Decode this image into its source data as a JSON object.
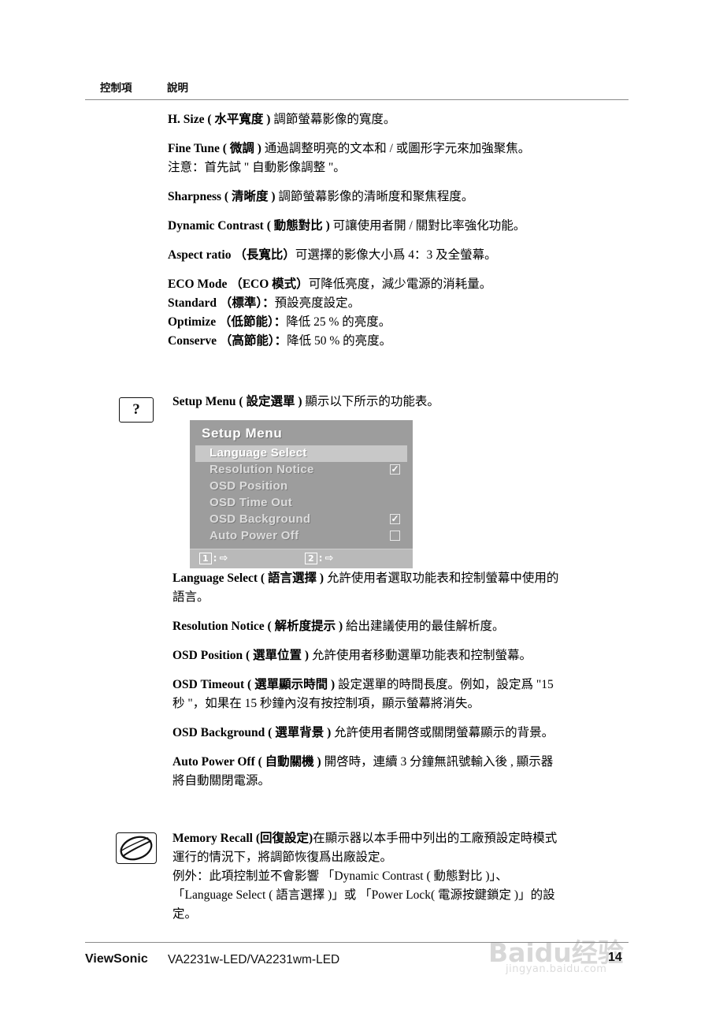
{
  "header": {
    "col1": "控制項",
    "col2": "說明"
  },
  "entries": [
    {
      "id": "h-size",
      "lines": [
        {
          "bold": "H. Size ( 水平寬度 ) ",
          "rest": "調節螢幕影像的寬度。"
        }
      ]
    },
    {
      "id": "fine-tune",
      "lines": [
        {
          "bold": "Fine Tune ( 微調 ) ",
          "rest": "通過調整明亮的文本和 / 或圖形字元來加強聚焦。"
        },
        {
          "bold": "",
          "rest": "注意：首先試 \" 自動影像調整 \"。"
        }
      ]
    },
    {
      "id": "sharpness",
      "lines": [
        {
          "bold": "Sharpness ( 清晰度 ) ",
          "rest": "調節螢幕影像的清晰度和聚焦程度。"
        }
      ]
    },
    {
      "id": "dynamic-contrast",
      "lines": [
        {
          "bold": "Dynamic Contrast ( 動態對比 ) ",
          "rest": "可讓使用者開 / 關對比率強化功能。"
        }
      ]
    },
    {
      "id": "aspect-ratio",
      "lines": [
        {
          "bold": "Aspect ratio （長寬比）",
          "rest": "可選擇的影像大小爲 4：3 及全螢幕。"
        }
      ]
    },
    {
      "id": "eco-mode",
      "lines": [
        {
          "bold": "ECO Mode （ECO 模式）",
          "rest": "可降低亮度，減少電源的消耗量。"
        },
        {
          "bold": "Standard （標準）：",
          "rest": "預設亮度設定。"
        },
        {
          "bold": "Optimize （低節能）：",
          "rest": "降低 25 % 的亮度。"
        },
        {
          "bold": "Conserve （高節能）：",
          "rest": "降低 50 % 的亮度。"
        }
      ]
    }
  ],
  "setup_menu_line": {
    "bold": "Setup Menu ( 設定選單 ) ",
    "rest": "顯示以下所示的功能表。"
  },
  "question_icon": "?",
  "osd": {
    "title": "Setup Menu",
    "rows": [
      {
        "label": "Language Select",
        "selected": true,
        "box": "none"
      },
      {
        "label": "Resolution Notice",
        "selected": false,
        "box": "checked"
      },
      {
        "label": "OSD Position",
        "selected": false,
        "box": "none"
      },
      {
        "label": "OSD Time Out",
        "selected": false,
        "box": "none"
      },
      {
        "label": "OSD Background",
        "selected": false,
        "box": "checked"
      },
      {
        "label": "Auto Power Off",
        "selected": false,
        "box": "empty"
      }
    ],
    "keys": [
      {
        "num": "1",
        "sep": ":",
        "glyph": "⇨"
      },
      {
        "num": "2",
        "sep": ":",
        "glyph": "⇨"
      }
    ],
    "check_glyph": "☑",
    "colors": {
      "background": "#9d9d9d",
      "highlight": "#c8c8c8",
      "footer": "#b9b9b9"
    }
  },
  "entries2": [
    {
      "id": "language-select",
      "lines": [
        {
          "bold": "Language Select ( 語言選擇 ) ",
          "rest": "允許使用者選取功能表和控制螢幕中使用的"
        },
        {
          "bold": "",
          "rest": "語言。"
        }
      ]
    },
    {
      "id": "resolution-notice",
      "lines": [
        {
          "bold": "Resolution Notice ( 解析度提示 ) ",
          "rest": "給出建議使用的最佳解析度。"
        }
      ]
    },
    {
      "id": "osd-position",
      "lines": [
        {
          "bold": "OSD Position ( 選單位置 ) ",
          "rest": "允許使用者移動選單功能表和控制螢幕。"
        }
      ]
    },
    {
      "id": "osd-timeout",
      "lines": [
        {
          "bold": "OSD Timeout ( 選單顯示時間 ) ",
          "rest": "設定選單的時間長度。例如，設定爲 \"15"
        },
        {
          "bold": "",
          "rest": "秒 \"，如果在 15 秒鐘內沒有按控制項，顯示螢幕將消失。"
        }
      ]
    },
    {
      "id": "osd-background",
      "lines": [
        {
          "bold": "OSD Background ( 選單背景 ) ",
          "rest": "允許使用者開啓或關閉螢幕顯示的背景。"
        }
      ]
    },
    {
      "id": "auto-power-off",
      "lines": [
        {
          "bold": "Auto Power Off ( 自動關機 ) ",
          "rest": "開啓時，連續 3 分鐘無訊號輸入後 , 顯示器"
        },
        {
          "bold": "",
          "rest": "將自動關閉電源。"
        }
      ]
    }
  ],
  "memory_recall": {
    "lines": [
      {
        "bold": "Memory Recall (回復設定)",
        "rest": "在顯示器以本手冊中列出的工廠預設定時模式"
      },
      {
        "bold": "",
        "rest": "運行的情況下，將調節恢復爲出廠設定。"
      },
      {
        "bold": "",
        "rest": "例外：此項控制並不會影響 「Dynamic Contrast ( 動態對比 )」、"
      },
      {
        "bold": "",
        "rest": "「Language Select ( 語言選擇 )」或 「Power Lock( 電源按鍵鎖定 )」的設"
      },
      {
        "bold": "",
        "rest": "定。"
      }
    ]
  },
  "footer": {
    "brand": "ViewSonic",
    "model": "VA2231w-LED/VA2231wm-LED",
    "page_number": "14"
  },
  "watermark": {
    "main": "Baidu经验",
    "sub": "jingyan.baidu.com"
  }
}
